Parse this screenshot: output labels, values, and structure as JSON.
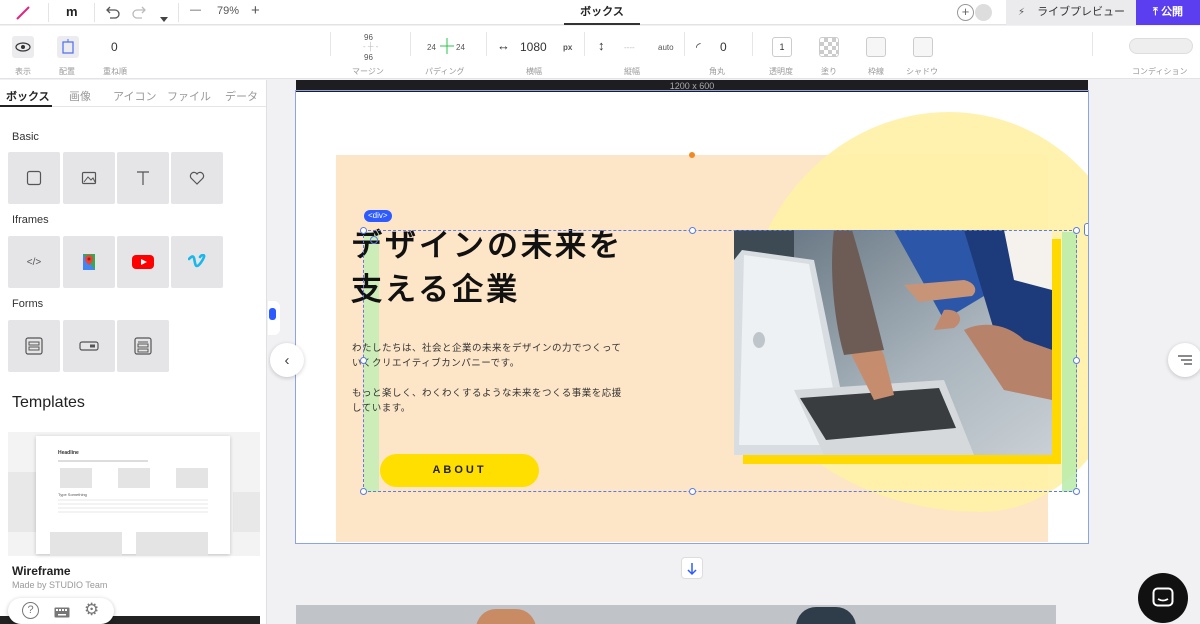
{
  "topbar": {
    "logo": "m",
    "zoom": "79%",
    "zoom_minus": "—",
    "zoom_plus": "+",
    "document_tab": "ボックス",
    "live_preview": "ライブプレビュー",
    "publish": "公開"
  },
  "propbar": {
    "display_label": "表示",
    "align_label": "配置",
    "stack_order_value": "0",
    "stack_order_label": "重ね順",
    "margin_top": "96",
    "margin_bottom": "96",
    "margin_label": "マージン",
    "padding_left": "24",
    "padding_right": "24",
    "padding_label": "パディング",
    "width_value": "1080",
    "width_unit": "px",
    "width_label": "横幅",
    "height_value": "----",
    "height_unit": "auto",
    "height_label": "縦幅",
    "radius_value": "0",
    "radius_label": "角丸",
    "opacity_value": "1",
    "opacity_label": "透明度",
    "fill_label": "塗り",
    "border_label": "枠線",
    "shadow_label": "シャドウ",
    "condition_label": "コンディション"
  },
  "left_panel": {
    "tabs": [
      {
        "label": "ボックス"
      },
      {
        "label": "画像"
      },
      {
        "label": "アイコン"
      },
      {
        "label": "ファイル"
      },
      {
        "label": "データ"
      }
    ],
    "sections": {
      "basic": "Basic",
      "iframes": "Iframes",
      "forms": "Forms"
    },
    "templates_heading": "Templates",
    "template": {
      "name": "Wireframe",
      "author": "Made by STUDIO Team",
      "preview_headline": "Headline",
      "preview_item": "Type Something"
    }
  },
  "canvas": {
    "size_label": "1200 x 600",
    "element_tag": "<div>",
    "hero_title": "デザインの未来を\n支える企業",
    "hero_body": "わたしたちは、社会と企業の未来をデザインの力でつくって\nいくクリエイティブカンパニーです。\n\nもっと楽しく、わくわくするような未来をつくる事業を応援\nしています。",
    "about_button": "ABOUT"
  },
  "colors": {
    "accent_publish": "#5a3ef0",
    "selection": "#2d5bff",
    "hero_peach": "#fde5c8",
    "hero_yellow": "#ffdf00",
    "blob_yellow": "#fff1a6"
  }
}
